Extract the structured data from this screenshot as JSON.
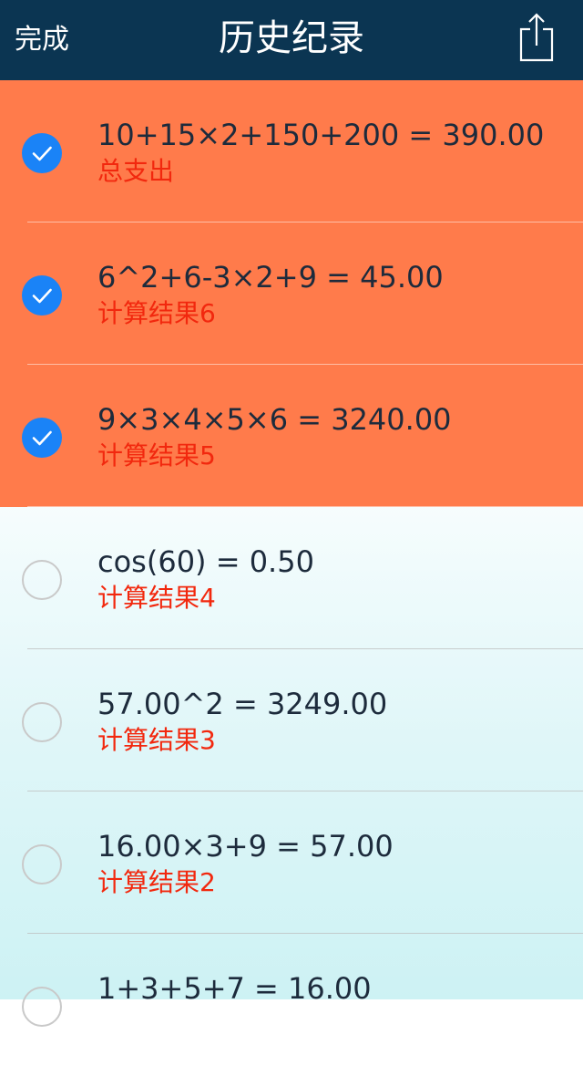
{
  "navbar": {
    "done_label": "完成",
    "title": "历史纪录",
    "share_icon": "share-icon"
  },
  "colors": {
    "navbar_bg": "#0b3552",
    "selected_row_bg": "#ff7b4b",
    "checkmark_blue": "#1a83f7",
    "note_red": "#f2280e"
  },
  "records": [
    {
      "expression": "10+15×2+150+200 = 390.00",
      "note": "总支出",
      "selected": true
    },
    {
      "expression": "6^2+6-3×2+9 = 45.00",
      "note": "计算结果6",
      "selected": true
    },
    {
      "expression": "9×3×4×5×6 = 3240.00",
      "note": "计算结果5",
      "selected": true
    },
    {
      "expression": "cos(60) = 0.50",
      "note": "计算结果4",
      "selected": false
    },
    {
      "expression": "57.00^2 = 3249.00",
      "note": "计算结果3",
      "selected": false
    },
    {
      "expression": "16.00×3+9 = 57.00",
      "note": "计算结果2",
      "selected": false
    },
    {
      "expression": "1+3+5+7 = 16.00",
      "note": "",
      "selected": false
    }
  ]
}
